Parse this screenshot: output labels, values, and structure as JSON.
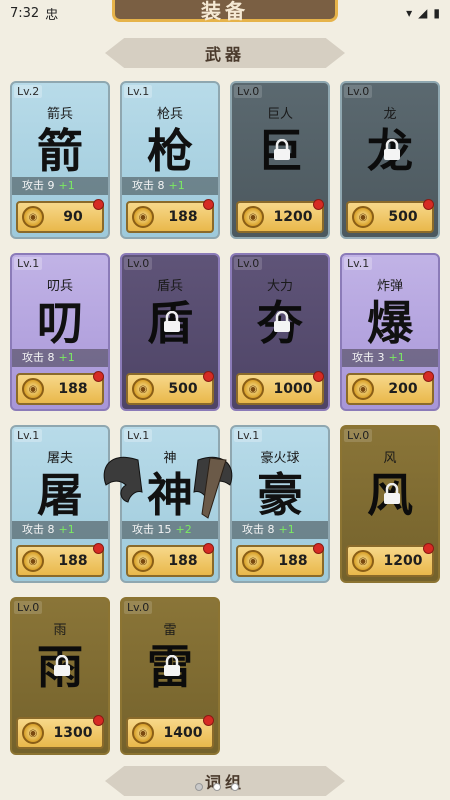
{
  "status": {
    "time": "7:32",
    "app_glyph": "忠"
  },
  "title": "装备",
  "sections": {
    "weapons": "武器",
    "words": "词组"
  },
  "cards": [
    {
      "lv": "Lv.2",
      "name": "箭兵",
      "glyph": "箭",
      "stat": "攻击 9",
      "plus": "+1",
      "price": "90",
      "color": "blue",
      "locked": false
    },
    {
      "lv": "Lv.1",
      "name": "枪兵",
      "glyph": "枪",
      "stat": "攻击 8",
      "plus": "+1",
      "price": "188",
      "color": "blue",
      "locked": false
    },
    {
      "lv": "Lv.0",
      "name": "巨人",
      "glyph": "巨",
      "stat": "",
      "plus": "",
      "price": "1200",
      "color": "blue",
      "locked": true
    },
    {
      "lv": "Lv.0",
      "name": "龙",
      "glyph": "龙",
      "stat": "",
      "plus": "",
      "price": "500",
      "color": "blue",
      "locked": true
    },
    {
      "lv": "Lv.1",
      "name": "叨兵",
      "glyph": "叨",
      "stat": "攻击 8",
      "plus": "+1",
      "price": "188",
      "color": "purple",
      "locked": false
    },
    {
      "lv": "Lv.0",
      "name": "盾兵",
      "glyph": "盾",
      "stat": "",
      "plus": "",
      "price": "500",
      "color": "purple",
      "locked": true
    },
    {
      "lv": "Lv.0",
      "name": "大力",
      "glyph": "夯",
      "stat": "",
      "plus": "",
      "price": "1000",
      "color": "purple",
      "locked": true
    },
    {
      "lv": "Lv.1",
      "name": "炸弹",
      "glyph": "爆",
      "stat": "攻击 3",
      "plus": "+1",
      "price": "200",
      "color": "purple",
      "locked": false
    },
    {
      "lv": "Lv.1",
      "name": "屠夫",
      "glyph": "屠",
      "stat": "攻击 8",
      "plus": "+1",
      "price": "188",
      "color": "blue",
      "locked": false
    },
    {
      "lv": "Lv.1",
      "name": "神",
      "glyph": "神",
      "stat": "攻击 15",
      "plus": "+2",
      "price": "188",
      "color": "blue",
      "locked": false
    },
    {
      "lv": "Lv.1",
      "name": "豪火球",
      "glyph": "豪",
      "stat": "攻击 8",
      "plus": "+1",
      "price": "188",
      "color": "blue",
      "locked": false
    },
    {
      "lv": "Lv.0",
      "name": "风",
      "glyph": "风",
      "stat": "",
      "plus": "",
      "price": "1200",
      "color": "gold",
      "locked": true
    },
    {
      "lv": "Lv.0",
      "name": "雨",
      "glyph": "雨",
      "stat": "",
      "plus": "",
      "price": "1300",
      "color": "gold",
      "locked": true
    },
    {
      "lv": "Lv.0",
      "name": "雷",
      "glyph": "雷",
      "stat": "",
      "plus": "",
      "price": "1400",
      "color": "gold",
      "locked": true
    }
  ]
}
